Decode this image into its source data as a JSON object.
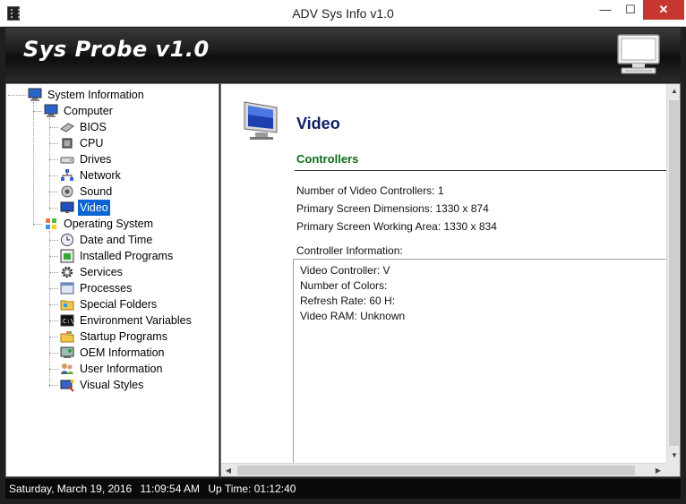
{
  "window": {
    "title": "ADV Sys Info v1.0",
    "minimize": "—",
    "maximize": "☐",
    "close": "✕"
  },
  "banner": {
    "title": "Sys Probe v1.0"
  },
  "tree": {
    "root": "System Information",
    "computer": "Computer",
    "bios": "BIOS",
    "cpu": "CPU",
    "drives": "Drives",
    "network": "Network",
    "sound": "Sound",
    "video": "Video",
    "os": "Operating System",
    "datetime": "Date and Time",
    "installed": "Installed Programs",
    "services": "Services",
    "processes": "Processes",
    "special": "Special Folders",
    "env": "Environment Variables",
    "startup": "Startup Programs",
    "oem": "OEM Information",
    "user": "User Information",
    "visual": "Visual Styles"
  },
  "content": {
    "title": "Video",
    "heading": "Controllers",
    "num_controllers": "Number of Video Controllers: 1",
    "screen_dims": "Primary Screen Dimensions: 1330 x 874",
    "working_area": "Primary Screen Working Area: 1330 x 834",
    "controller_info_label": "Controller Information:",
    "controller_lines": {
      "0": "Video Controller: V",
      "1": "Number of Colors:",
      "2": "Refresh Rate: 60 H:",
      "3": "Video RAM: Unknown"
    }
  },
  "status": {
    "date": "Saturday, March 19, 2016",
    "time": "11:09:54 AM",
    "uptime": "Up Time: 01:12:40"
  },
  "colors": {
    "selection": "#0a64d4",
    "title_text": "#0c1f66",
    "heading_text": "#0b6b1f"
  }
}
